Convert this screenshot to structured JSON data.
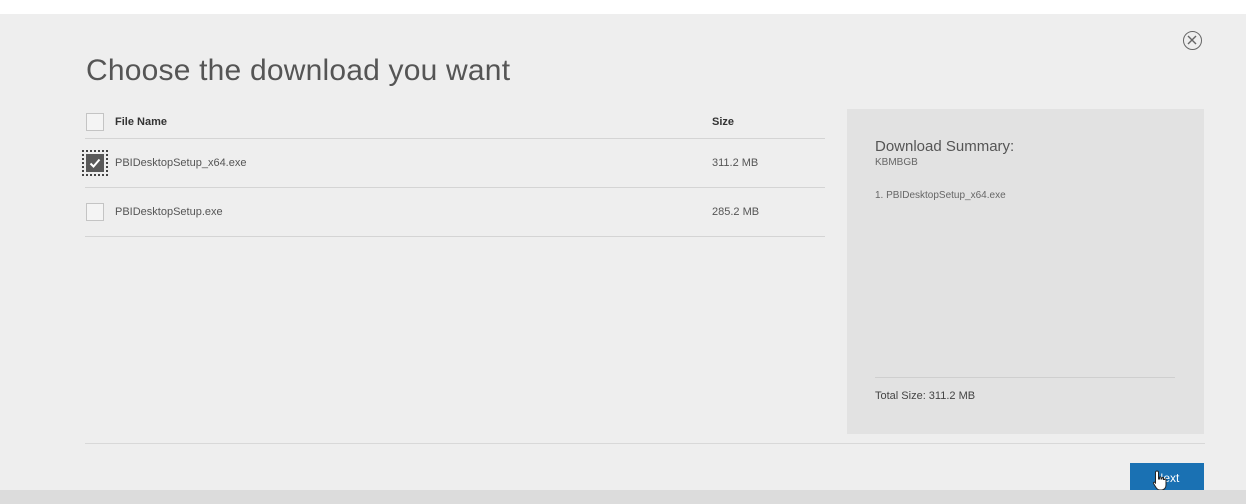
{
  "dialog": {
    "title": "Choose the download you want",
    "close_icon": "close-circle-icon"
  },
  "table": {
    "headers": {
      "name": "File Name",
      "size": "Size"
    },
    "rows": [
      {
        "name": "PBIDesktopSetup_x64.exe",
        "size": "311.2 MB",
        "checked": true
      },
      {
        "name": "PBIDesktopSetup.exe",
        "size": "285.2 MB",
        "checked": false
      }
    ]
  },
  "summary": {
    "title": "Download Summary:",
    "subtitle": "KBMBGB",
    "items": [
      "1. PBIDesktopSetup_x64.exe"
    ],
    "total": "Total Size: 311.2 MB"
  },
  "footer": {
    "next_label": "Next"
  },
  "colors": {
    "accent": "#1a71b3",
    "panel": "#e2e2e2",
    "background": "#eeeeee"
  }
}
